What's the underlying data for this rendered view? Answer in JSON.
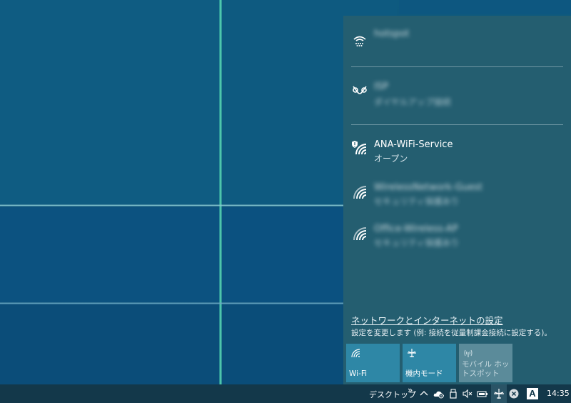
{
  "networks": [
    {
      "name": "hotspot",
      "status": "",
      "blurred": true,
      "icon": "cellular-signal-icon"
    },
    {
      "name": "ISP",
      "status": "ダイヤルアップ接続",
      "blurred": true,
      "icon": "dialup-connection-icon"
    },
    {
      "name": "ANA-WiFi-Service",
      "status": "オープン",
      "blurred": false,
      "icon": "wifi-open-shield-icon"
    },
    {
      "name": "WirelessNetwork-Guest",
      "status": "セキュリティ保護あり",
      "blurred": true,
      "icon": "wifi-icon"
    },
    {
      "name": "Office-Wireless-AP",
      "status": "セキュリティ保護あり",
      "blurred": true,
      "icon": "wifi-icon"
    }
  ],
  "settings": {
    "link": "ネットワークとインターネットの設定",
    "description": "設定を変更します (例: 接続を従量制課金接続に設定する)。"
  },
  "quick_actions": [
    {
      "label": "Wi-Fi",
      "state": "on",
      "icon": "wifi-icon"
    },
    {
      "label": "機内モード",
      "state": "on",
      "icon": "airplane-icon"
    },
    {
      "label": "モバイル ホットスポット",
      "state": "off",
      "icon": "hotspot-icon"
    }
  ],
  "taskbar": {
    "desktop_label": "デスクトップ",
    "overflow": "»",
    "clock": "14:35",
    "ime_label": "A",
    "icons": [
      "chevron-up-icon",
      "onedrive-icon",
      "usb-icon",
      "volume-mute-icon",
      "battery-icon",
      "airplane-icon",
      "close-circle-icon",
      "ime-icon"
    ]
  },
  "colors": {
    "flyout_bg": "#245e70",
    "tile_on": "#2e87a6",
    "tile_off": "#5b8b9a",
    "taskbar_bg": "#13384a"
  }
}
